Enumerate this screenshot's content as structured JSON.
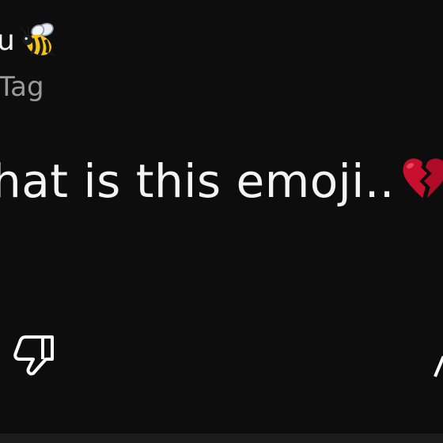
{
  "comment": {
    "author_name": "u",
    "author_tag": "Tag",
    "text": "hat is this emoji..",
    "author_emoji_icon": "honeybee-icon",
    "text_emoji_icon": "broken-heart-icon"
  },
  "actions": {
    "dislike_icon": "thumbs-down-icon",
    "partial_action_icon": "arrow-up-icon"
  },
  "colors": {
    "background": "#0d0d0d",
    "text_primary": "#f2f2f2",
    "text_secondary": "#9a9a9a",
    "heart_red": "#c8102e"
  }
}
